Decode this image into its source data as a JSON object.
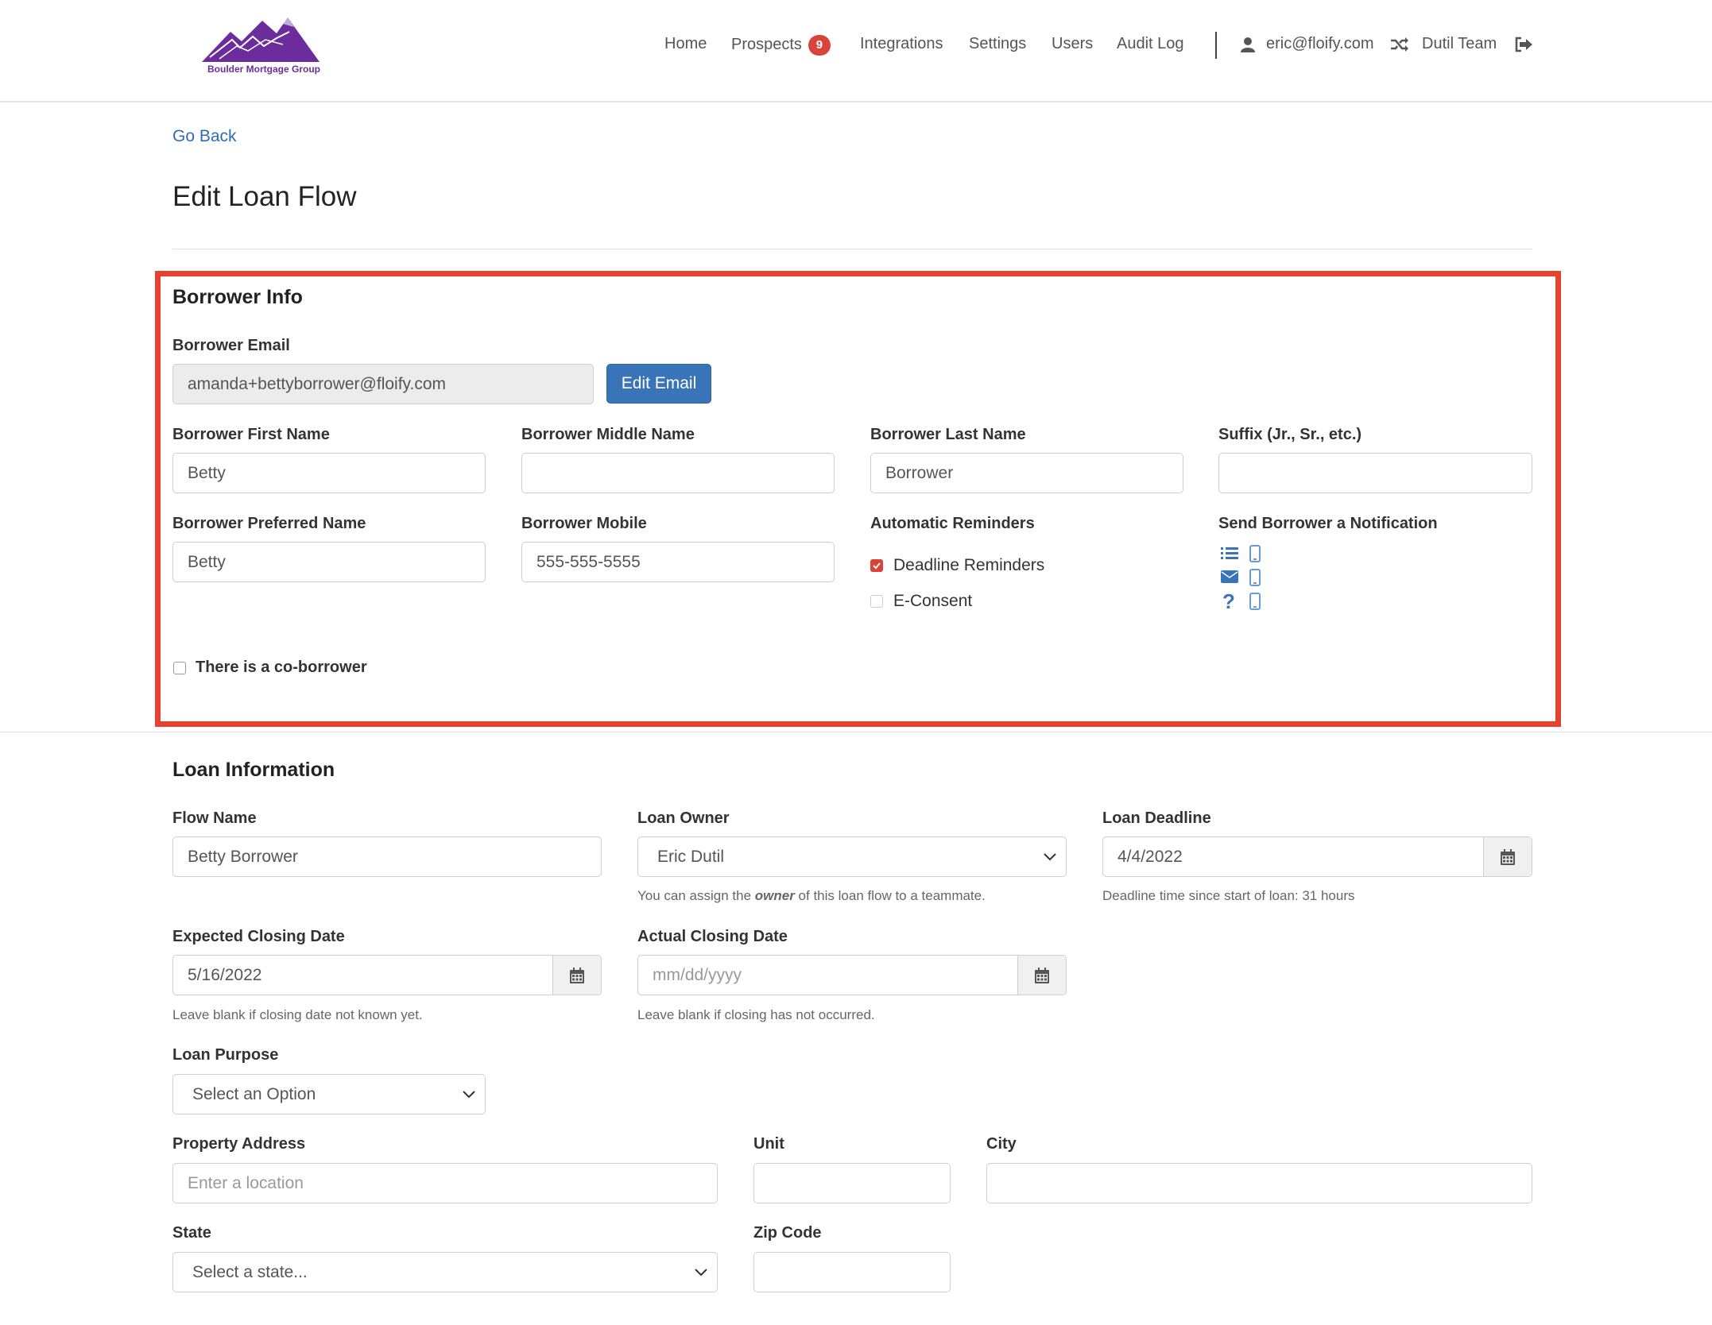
{
  "header": {
    "logo_text": "Boulder Mortgage Group",
    "nav": {
      "home": "Home",
      "prospects": "Prospects",
      "prospects_badge": "9",
      "integrations": "Integrations",
      "settings": "Settings",
      "users": "Users",
      "audit_log": "Audit Log",
      "user_email": "eric@floify.com",
      "team": "Dutil Team"
    },
    "icons": {
      "user": "user-icon",
      "switch_team": "shuffle-icon",
      "logout": "sign-out-icon"
    }
  },
  "page": {
    "go_back": "Go Back",
    "title": "Edit Loan Flow"
  },
  "borrower_info": {
    "title": "Borrower Info",
    "email_label": "Borrower Email",
    "email_value": "amanda+bettyborrower@floify.com",
    "edit_email_button": "Edit Email",
    "first_name_label": "Borrower First Name",
    "first_name_value": "Betty",
    "middle_name_label": "Borrower Middle Name",
    "middle_name_value": "",
    "last_name_label": "Borrower Last Name",
    "last_name_value": "Borrower",
    "suffix_label": "Suffix (Jr., Sr., etc.)",
    "suffix_value": "",
    "preferred_name_label": "Borrower Preferred Name",
    "preferred_name_value": "Betty",
    "mobile_label": "Borrower Mobile",
    "mobile_value": "555-555-5555",
    "reminders_label": "Automatic Reminders",
    "deadline_reminders": "Deadline Reminders",
    "deadline_reminders_checked": true,
    "econsent": "E-Consent",
    "econsent_checked": false,
    "notification_label": "Send Borrower a Notification",
    "notification_icons": [
      "list-icon",
      "mobile-icon",
      "envelope-icon",
      "mobile-icon",
      "question-icon",
      "mobile-icon"
    ],
    "co_borrower": "There is a co-borrower",
    "co_borrower_checked": false
  },
  "loan_info": {
    "title": "Loan Information",
    "flow_name_label": "Flow Name",
    "flow_name_value": "Betty Borrower",
    "loan_owner_label": "Loan Owner",
    "loan_owner_value": "Eric Dutil",
    "loan_owner_help_1": "You can assign the ",
    "loan_owner_help_em": "owner",
    "loan_owner_help_2": " of this loan flow to a teammate.",
    "loan_deadline_label": "Loan Deadline",
    "loan_deadline_value": "4/4/2022",
    "loan_deadline_help": "Deadline time since start of loan: 31 hours",
    "expected_closing_label": "Expected Closing Date",
    "expected_closing_value": "5/16/2022",
    "expected_closing_help": "Leave blank if closing date not known yet.",
    "actual_closing_label": "Actual Closing Date",
    "actual_closing_placeholder": "mm/dd/yyyy",
    "actual_closing_help": "Leave blank if closing has not occurred.",
    "loan_purpose_label": "Loan Purpose",
    "loan_purpose_value": "Select an Option",
    "property_address_label": "Property Address",
    "property_address_placeholder": "Enter a location",
    "unit_label": "Unit",
    "city_label": "City",
    "state_label": "State",
    "state_value": "Select a state...",
    "zip_label": "Zip Code"
  },
  "colors": {
    "accent": "#3a74b8",
    "link": "#2d6db5",
    "highlight_border": "#e8412f",
    "badge": "#d9443a",
    "logo": "#6c2d9c"
  }
}
